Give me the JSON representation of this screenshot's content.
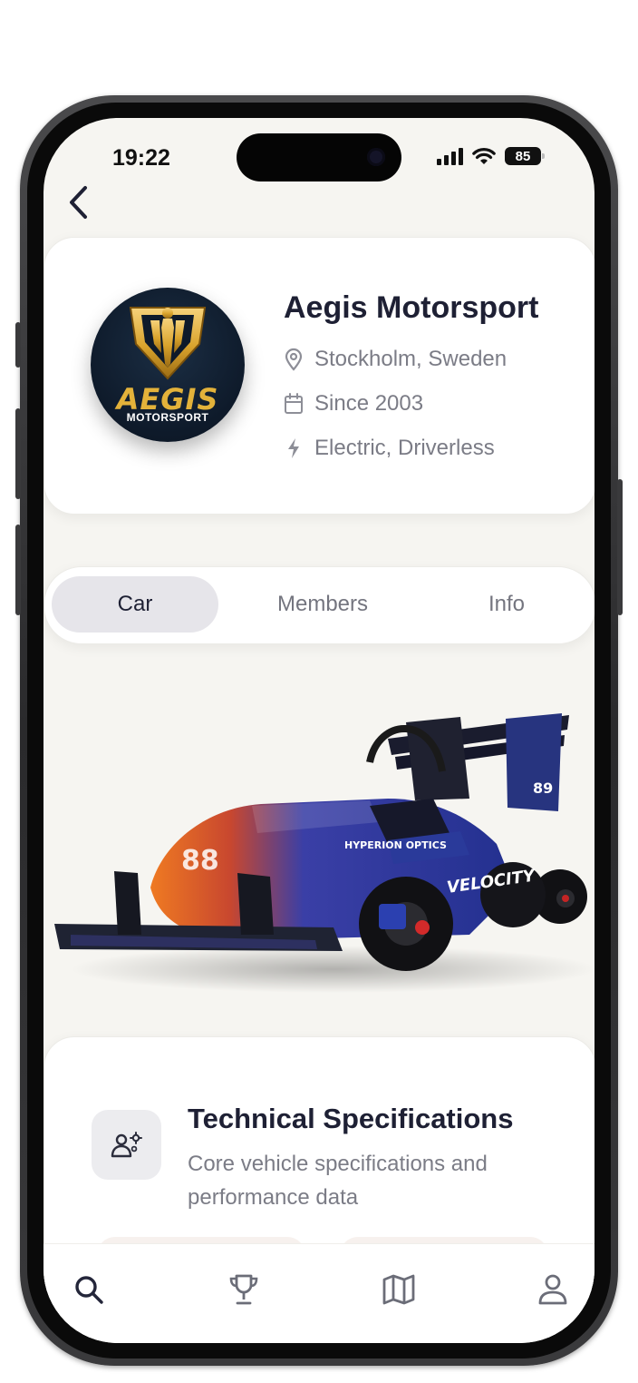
{
  "status_bar": {
    "time": "19:22",
    "battery": "85"
  },
  "team": {
    "logo_text": "AEGIS",
    "logo_subtext": "MOTORSPORT",
    "name": "Aegis Motorsport",
    "location": "Stockholm, Sweden",
    "since": "Since 2003",
    "category": "Electric, Driverless"
  },
  "tabs": [
    {
      "label": "Car",
      "active": true
    },
    {
      "label": "Members",
      "active": false
    },
    {
      "label": "Info",
      "active": false
    }
  ],
  "car": {
    "sponsor_text": "HYPERION OPTICS",
    "sidepod_text": "VELOCITY",
    "number": "88",
    "wing_number": "89"
  },
  "specs": {
    "title": "Technical Specifications",
    "subtitle": "Core vehicle specifications and performance data"
  },
  "nav": {
    "icons": [
      "search-icon",
      "trophy-icon",
      "map-icon",
      "profile-icon"
    ]
  },
  "colors": {
    "background": "#f6f5f1",
    "card": "#ffffff",
    "text_primary": "#1e2034",
    "text_secondary": "#7b7c86",
    "tab_active": "#e6e5ea",
    "logo_gold": "#e3b23a",
    "logo_navy": "#0e1a2a"
  }
}
